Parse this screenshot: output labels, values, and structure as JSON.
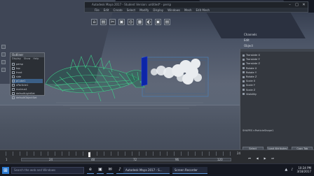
{
  "window": {
    "title": "Autodesk Maya 2017 - Student Version: untitled* - persp",
    "menus": [
      "File",
      "Edit",
      "Create",
      "Select",
      "Modify",
      "Display",
      "Windows",
      "Mesh",
      "Edit Mesh"
    ],
    "caption": {
      "minimize": "–",
      "maximize": "□",
      "close": "✕"
    }
  },
  "toolstrip": [
    "⌂",
    "▤",
    "✂",
    "▣",
    "◎",
    "▦",
    "◐",
    "▣",
    "▤"
  ],
  "outliner": {
    "title": "Outliner",
    "menus": [
      "Display",
      "Show",
      "Help"
    ],
    "items": [
      "persp",
      "top",
      "front",
      "side",
      "pCube1",
      "nParticle1",
      "nucleus1",
      "defaultLightSet",
      "defaultObjectSet"
    ],
    "selected_index": 4
  },
  "right_labels": [
    "Channels",
    "Edit",
    "Object"
  ],
  "attribute_editor": {
    "rows": [
      "Translate X",
      "Translate Y",
      "Translate Z",
      "Rotate X",
      "Rotate Y",
      "Rotate Z",
      "Scale X",
      "Scale Y",
      "Scale Z",
      "Visibility"
    ],
    "node_label": "SHAPES  nParticleShape1",
    "buttons": [
      "Select",
      "Load Attributes",
      "Copy Tab"
    ]
  },
  "timeline": {
    "frames": [
      "1",
      "24",
      "48",
      "72",
      "96",
      "120"
    ],
    "current_frame": "24",
    "controls": [
      "⏮",
      "◀",
      "▶",
      "⏭"
    ]
  },
  "taskbar": {
    "search_placeholder": "Search the web and Windows",
    "apps": [
      "e",
      "▣",
      "✉",
      "♪"
    ],
    "tasks": [
      "Autodesk Maya 2017 - S...",
      "Screen Recorder"
    ],
    "clock_time": "10:24 PM",
    "clock_date": "3/18/2017"
  }
}
